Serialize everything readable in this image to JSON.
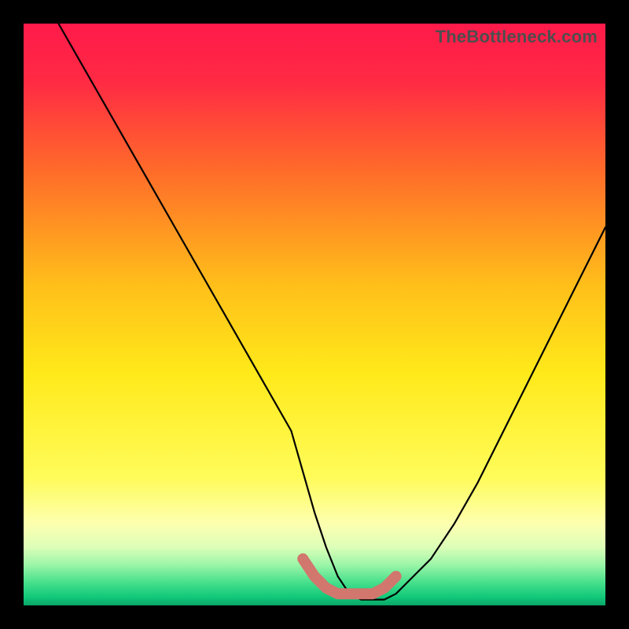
{
  "watermark": "TheBottleneck.com",
  "chart_data": {
    "type": "line",
    "title": "",
    "xlabel": "",
    "ylabel": "",
    "xlim": [
      0,
      100
    ],
    "ylim": [
      0,
      100
    ],
    "grid": false,
    "legend": false,
    "series": [
      {
        "name": "bottleneck-curve",
        "color": "#000000",
        "x": [
          6,
          10,
          14,
          18,
          22,
          26,
          30,
          34,
          38,
          42,
          46,
          48,
          50,
          52,
          54,
          56,
          58,
          60,
          62,
          64,
          66,
          70,
          74,
          78,
          82,
          86,
          90,
          94,
          98,
          100
        ],
        "values": [
          100,
          93,
          86,
          79,
          72,
          65,
          58,
          51,
          44,
          37,
          30,
          23,
          16,
          10,
          5,
          2,
          1,
          1,
          1,
          2,
          4,
          8,
          14,
          21,
          29,
          37,
          45,
          53,
          61,
          65
        ]
      },
      {
        "name": "optimal-range-marker",
        "color": "#d1776d",
        "x": [
          48,
          50,
          52,
          54,
          56,
          58,
          60,
          62,
          64
        ],
        "values": [
          8,
          5,
          3,
          2,
          2,
          2,
          2,
          3,
          5
        ]
      }
    ],
    "background_gradient": {
      "stops": [
        {
          "pos": 0.0,
          "color": "#ff1a4a"
        },
        {
          "pos": 0.1,
          "color": "#ff2a44"
        },
        {
          "pos": 0.25,
          "color": "#ff6a2a"
        },
        {
          "pos": 0.45,
          "color": "#ffbf1a"
        },
        {
          "pos": 0.6,
          "color": "#ffe91a"
        },
        {
          "pos": 0.78,
          "color": "#fffc5a"
        },
        {
          "pos": 0.86,
          "color": "#fdffb0"
        },
        {
          "pos": 0.9,
          "color": "#dcffb8"
        },
        {
          "pos": 0.93,
          "color": "#9cf5a8"
        },
        {
          "pos": 0.96,
          "color": "#48e08c"
        },
        {
          "pos": 0.985,
          "color": "#12c97a"
        },
        {
          "pos": 1.0,
          "color": "#0aa668"
        }
      ]
    }
  }
}
